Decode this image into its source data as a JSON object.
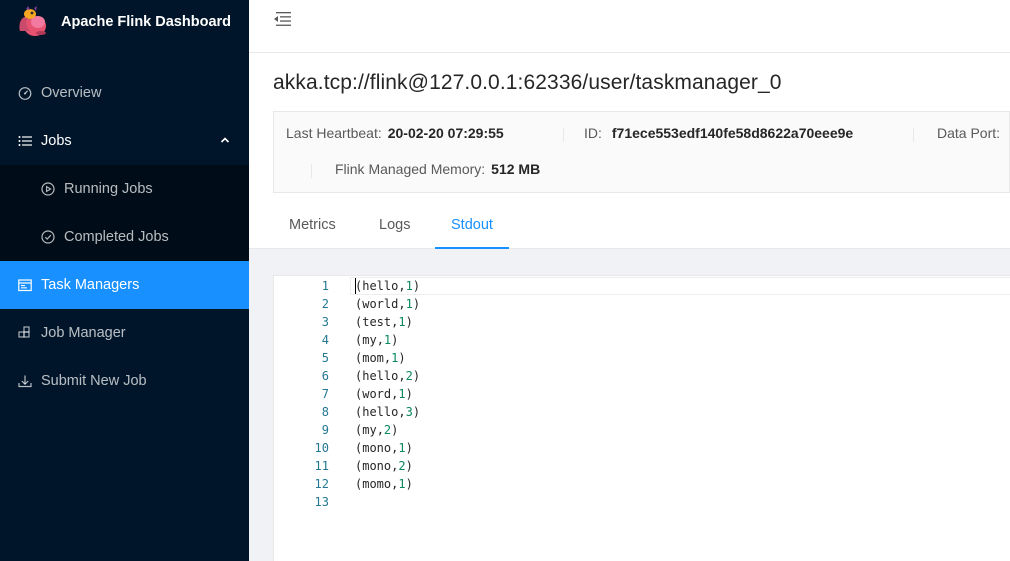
{
  "app": {
    "title": "Apache Flink Dashboard"
  },
  "sidebar": {
    "items": [
      {
        "label": "Overview",
        "icon": "dashboard-icon"
      },
      {
        "label": "Jobs",
        "icon": "unordered-list-icon",
        "expanded": true,
        "children": [
          {
            "label": "Running Jobs",
            "icon": "play-circle-icon"
          },
          {
            "label": "Completed Jobs",
            "icon": "check-circle-icon"
          }
        ]
      },
      {
        "label": "Task Managers",
        "icon": "schedule-icon",
        "active": true
      },
      {
        "label": "Job Manager",
        "icon": "build-icon"
      },
      {
        "label": "Submit New Job",
        "icon": "upload-icon"
      }
    ]
  },
  "page": {
    "title": "akka.tcp://flink@127.0.0.1:62336/user/taskmanager_0",
    "details": {
      "heartbeat_label": "Last Heartbeat:",
      "heartbeat_value": "20-02-20 07:29:55",
      "id_label": "ID:",
      "id_value": "f71ece553edf140fe58d8622a70eee9e",
      "port_label": "Data Port:",
      "memory_label": "Flink Managed Memory:",
      "memory_value": "512 MB"
    },
    "tabs": [
      "Metrics",
      "Logs",
      "Stdout"
    ],
    "active_tab": "Stdout"
  },
  "stdout": {
    "lines": [
      {
        "n": "1",
        "word": "hello",
        "count": "1"
      },
      {
        "n": "2",
        "word": "world",
        "count": "1"
      },
      {
        "n": "3",
        "word": "test",
        "count": "1"
      },
      {
        "n": "4",
        "word": "my",
        "count": "1"
      },
      {
        "n": "5",
        "word": "mom",
        "count": "1"
      },
      {
        "n": "6",
        "word": "hello",
        "count": "2"
      },
      {
        "n": "7",
        "word": "word",
        "count": "1"
      },
      {
        "n": "8",
        "word": "hello",
        "count": "3"
      },
      {
        "n": "9",
        "word": "my",
        "count": "2"
      },
      {
        "n": "10",
        "word": "mono",
        "count": "1"
      },
      {
        "n": "11",
        "word": "mono",
        "count": "2"
      },
      {
        "n": "12",
        "word": "momo",
        "count": "1"
      },
      {
        "n": "13",
        "word": "",
        "count": ""
      }
    ]
  },
  "colors": {
    "sidebar_bg": "#001529",
    "submenu_bg": "#000c17",
    "accent": "#1890ff",
    "line_number": "#237893",
    "number_literal": "#09885a"
  }
}
